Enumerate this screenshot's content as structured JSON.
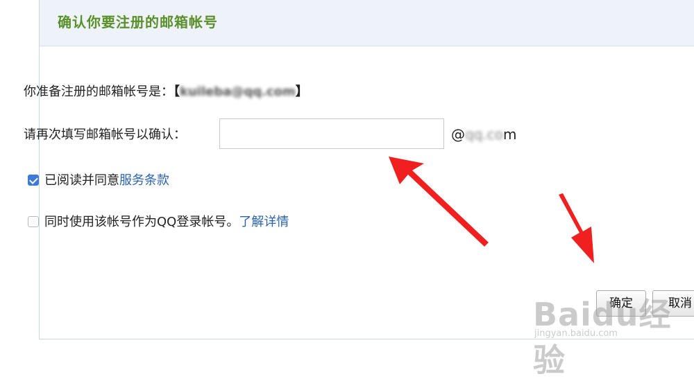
{
  "dialog": {
    "title": "确认你要注册的邮箱帐号"
  },
  "form": {
    "account_label": "你准备注册的邮箱帐号是：",
    "bracket_open": "【",
    "account_value": "kuileba@qq.com",
    "bracket_close": "】",
    "confirm_label": "请再次填写邮箱帐号以确认：",
    "confirm_input_value": "",
    "domain_at": "@",
    "domain_mid": "qq.co",
    "domain_end": "m",
    "agree_checked": true,
    "agree_text": "已阅读并同意",
    "agree_link": "服务条款",
    "qq_login_checked": false,
    "qq_login_text": "同时使用该帐号作为QQ登录帐号。",
    "qq_login_link": "了解详情"
  },
  "buttons": {
    "ok_label": "确定",
    "cancel_label": "取消"
  },
  "watermark": {
    "brand": "Baidu经验",
    "url": "jingyan.baidu.com"
  },
  "colors": {
    "title_green": "#5a8f2a",
    "link_blue": "#2a62b0",
    "checkbox_blue": "#3d7bd4",
    "arrow_red": "#f02020",
    "header_bg": "#eef3fa"
  }
}
